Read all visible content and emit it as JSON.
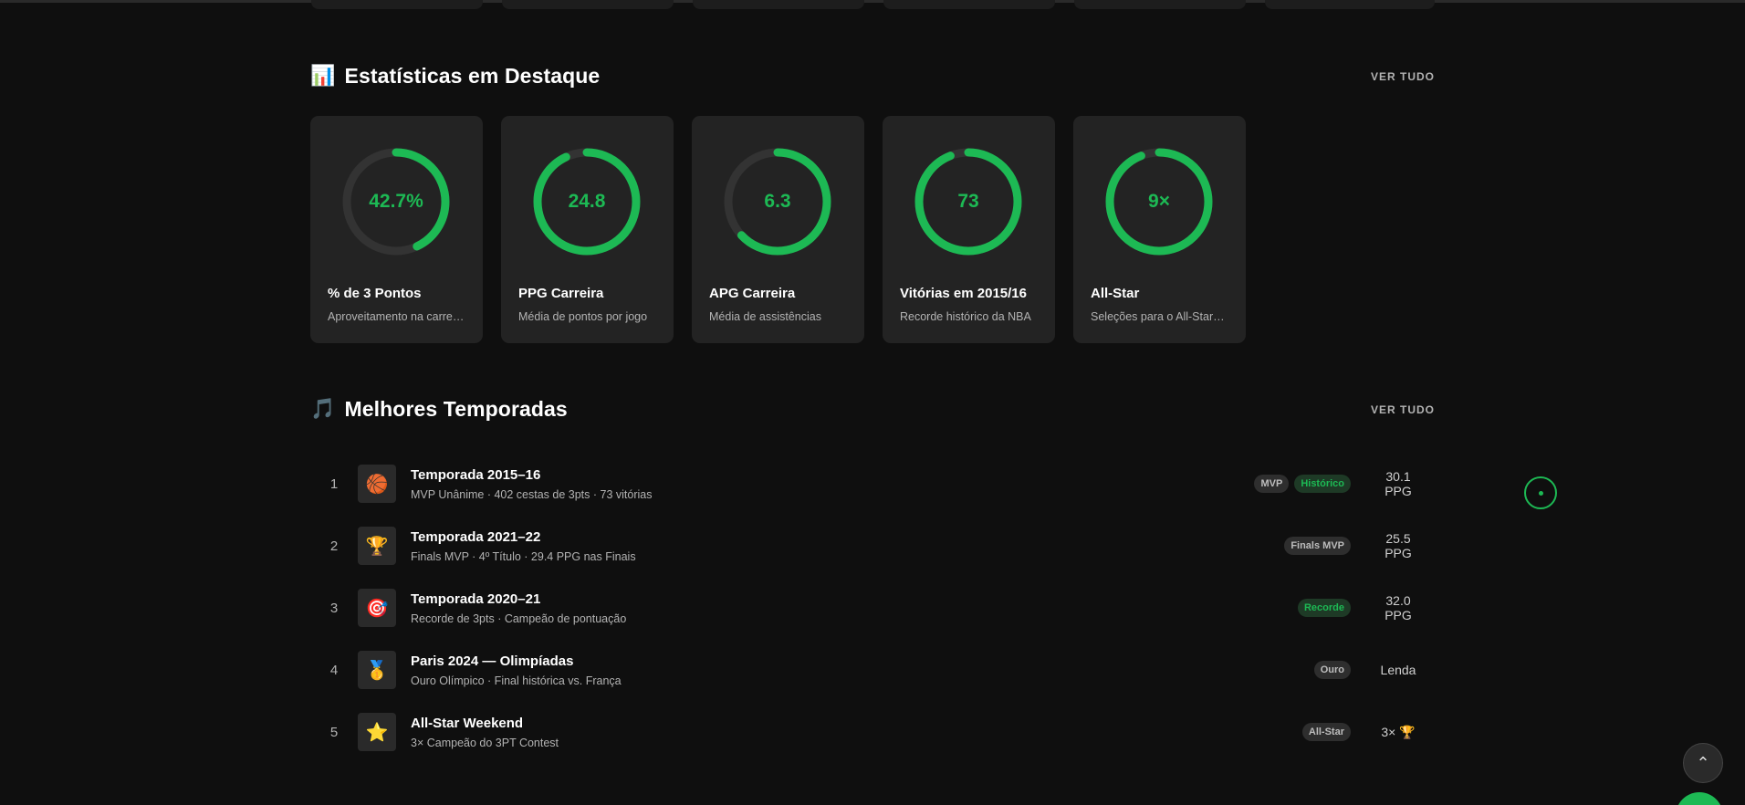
{
  "stats_section": {
    "icon": "bar-chart-emoji",
    "emoji": "📊",
    "title": "Estatísticas em Destaque",
    "see_all": "VER TUDO"
  },
  "stats": [
    {
      "value_text": "42.7%",
      "progress": 0.43,
      "title": "% de 3 Pontos",
      "subtitle": "Aproveitamento na carreira"
    },
    {
      "value_text": "24.8",
      "progress": 0.93,
      "title": "PPG Carreira",
      "subtitle": "Média de pontos por jogo"
    },
    {
      "value_text": "6.3",
      "progress": 0.63,
      "title": "APG Carreira",
      "subtitle": "Média de assistências"
    },
    {
      "value_text": "73",
      "progress": 0.94,
      "title": "Vitórias em 2015/16",
      "subtitle": "Recorde histórico da NBA"
    },
    {
      "value_text": "9×",
      "progress": 0.94,
      "title": "All-Star",
      "subtitle": "Seleções para o All-Star Game"
    }
  ],
  "seasons_section": {
    "icon": "music-note-emoji",
    "emoji": "🎵",
    "title": "Melhores Temporadas",
    "see_all": "VER TUDO"
  },
  "seasons": [
    {
      "rank": "1",
      "emoji": "🏀",
      "icon": "basketball-icon",
      "title": "Temporada 2015–16",
      "subtitle": "MVP Unânime · 402 cestas de 3pts · 73 vitórias",
      "badges": [
        {
          "label": "MVP",
          "style": "gray"
        },
        {
          "label": "Histórico",
          "style": "green"
        }
      ],
      "stat": "30.1 PPG"
    },
    {
      "rank": "2",
      "emoji": "🏆",
      "icon": "trophy-icon",
      "title": "Temporada 2021–22",
      "subtitle": "Finals MVP · 4º Título · 29.4 PPG nas Finais",
      "badges": [
        {
          "label": "Finals MVP",
          "style": "gray"
        }
      ],
      "stat": "25.5 PPG"
    },
    {
      "rank": "3",
      "emoji": "🎯",
      "icon": "target-icon",
      "title": "Temporada 2020–21",
      "subtitle": "Recorde de 3pts · Campeão de pontuação",
      "badges": [
        {
          "label": "Recorde",
          "style": "green"
        }
      ],
      "stat": "32.0 PPG"
    },
    {
      "rank": "4",
      "emoji": "🥇",
      "icon": "medal-icon",
      "title": "Paris 2024 — Olimpíadas",
      "subtitle": "Ouro Olímpico · Final histórica vs. França",
      "badges": [
        {
          "label": "Ouro",
          "style": "gray"
        }
      ],
      "stat": "Lenda"
    },
    {
      "rank": "5",
      "emoji": "⭐",
      "icon": "star-icon",
      "title": "All-Star Weekend",
      "subtitle": "3× Campeão do 3PT Contest",
      "badges": [
        {
          "label": "All-Star",
          "style": "gray"
        }
      ],
      "stat": "3× 🏆"
    }
  ],
  "colors": {
    "accent": "#1db954",
    "background": "#0f0f0f",
    "card": "#232323"
  },
  "controls": {
    "scroll_top_icon": "chevron-up-icon",
    "scroll_top_glyph": "⌃"
  }
}
